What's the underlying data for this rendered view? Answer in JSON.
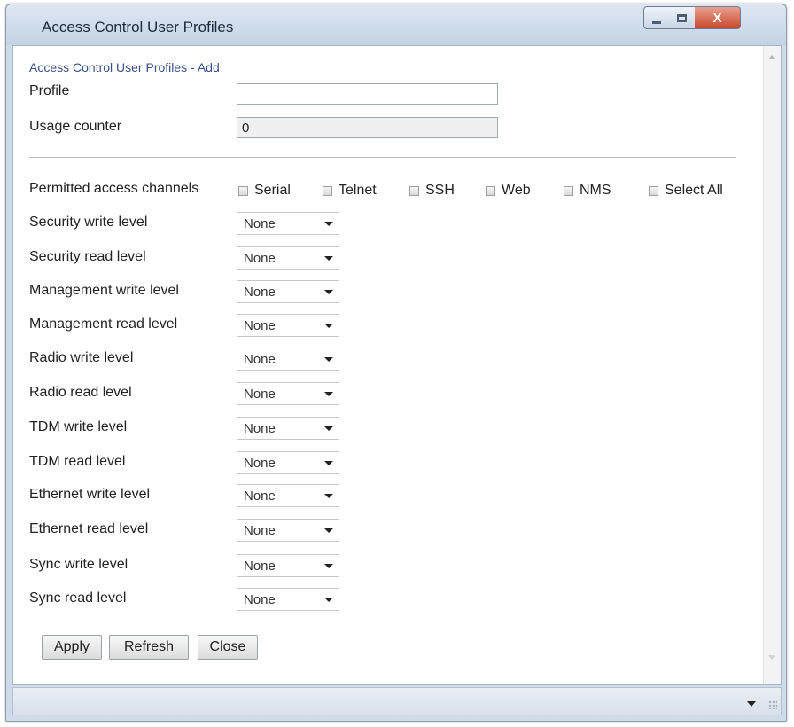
{
  "window": {
    "title": "Access Control User Profiles",
    "controls": {
      "minimize": "",
      "maximize": "",
      "close": "X"
    }
  },
  "form": {
    "subtitle": "Access Control User Profiles - Add",
    "profile": {
      "label": "Profile",
      "value": ""
    },
    "usage_counter": {
      "label": "Usage counter",
      "value": "0"
    },
    "permitted_channels": {
      "label": "Permitted access channels",
      "options": [
        {
          "label": "Serial",
          "checked": false
        },
        {
          "label": "Telnet",
          "checked": false
        },
        {
          "label": "SSH",
          "checked": false
        },
        {
          "label": "Web",
          "checked": false
        },
        {
          "label": "NMS",
          "checked": false
        },
        {
          "label": "Select All",
          "checked": false
        }
      ]
    },
    "levels": [
      {
        "label": "Security write level",
        "value": "None"
      },
      {
        "label": "Security read level",
        "value": "None"
      },
      {
        "label": "Management write level",
        "value": "None"
      },
      {
        "label": "Management read level",
        "value": "None"
      },
      {
        "label": "Radio write level",
        "value": "None"
      },
      {
        "label": "Radio read level",
        "value": "None"
      },
      {
        "label": "TDM write level",
        "value": "None"
      },
      {
        "label": "TDM read level",
        "value": "None"
      },
      {
        "label": "Ethernet write level",
        "value": "None"
      },
      {
        "label": "Ethernet read level",
        "value": "None"
      },
      {
        "label": "Sync write level",
        "value": "None"
      },
      {
        "label": "Sync read level",
        "value": "None"
      }
    ],
    "buttons": {
      "apply": "Apply",
      "refresh": "Refresh",
      "close": "Close"
    }
  },
  "colors": {
    "subtitle": "#3a4f8c",
    "titlebar": "#cfdbe9",
    "close_button": "#c9482d"
  }
}
